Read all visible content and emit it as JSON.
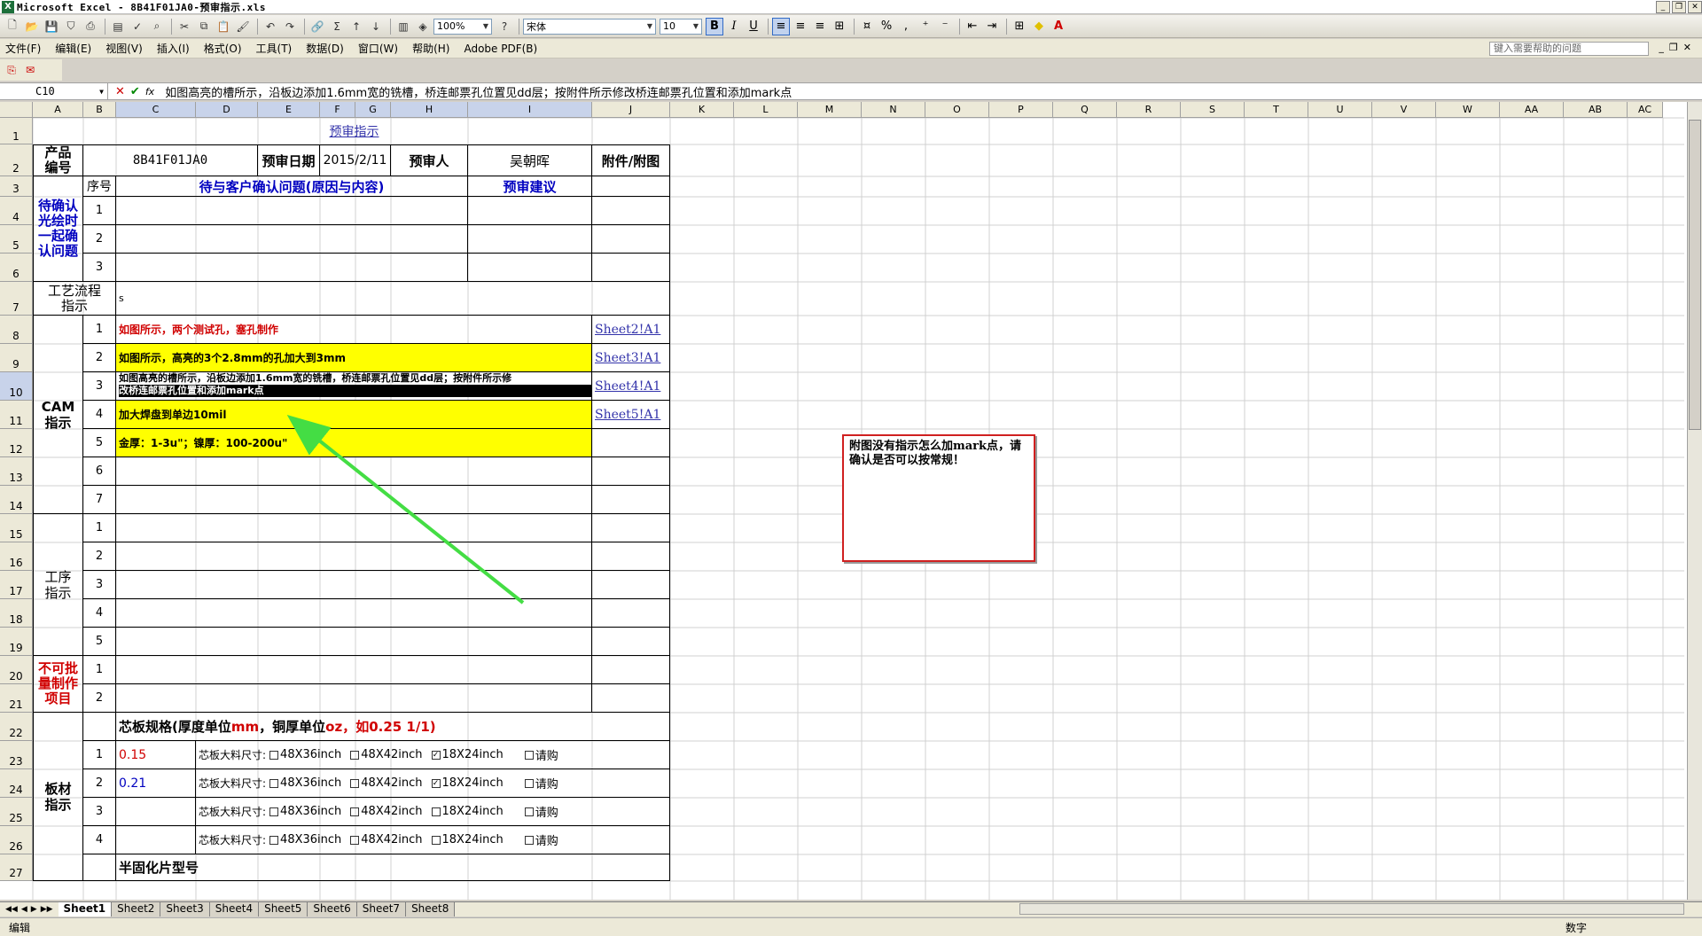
{
  "title": "Microsoft Excel - 8B41F01JA0-预审指示.xls",
  "toolbar": {
    "zoom": "100%",
    "font": "宋体",
    "size": "10",
    "bold": "B",
    "italic": "I",
    "underline": "U"
  },
  "menu": [
    "文件(F)",
    "编辑(E)",
    "视图(V)",
    "插入(I)",
    "格式(O)",
    "工具(T)",
    "数据(D)",
    "窗口(W)",
    "帮助(H)",
    "Adobe PDF(B)"
  ],
  "help_placeholder": "键入需要帮助的问题",
  "formula": {
    "cell": "C10",
    "value": "如图高亮的槽所示，沿板边添加1.6mm宽的铣槽，桥连邮票孔位置见dd层；按附件所示修改桥连邮票孔位置和添加mark点"
  },
  "columns": [
    "A",
    "B",
    "C",
    "D",
    "E",
    "F",
    "G",
    "H",
    "I",
    "J",
    "K",
    "L",
    "M",
    "N",
    "O",
    "P",
    "Q",
    "R",
    "S",
    "T",
    "U",
    "V",
    "W",
    "AA",
    "AB",
    "AC"
  ],
  "rows": [
    "1",
    "2",
    "3",
    "4",
    "5",
    "6",
    "7",
    "8",
    "9",
    "10",
    "11",
    "12",
    "13",
    "14",
    "15",
    "16",
    "17",
    "18",
    "19",
    "20",
    "21",
    "22",
    "23",
    "24",
    "25",
    "26",
    "27"
  ],
  "sheet": {
    "title_link": "预审指示",
    "product_label": "产品\n编号",
    "product_no": "8B41F01JA0",
    "date_label": "预审日期",
    "date": "2015/2/11",
    "reviewer_label": "预审人",
    "reviewer": "吴朝晖",
    "attach_label": "附件/附图",
    "seq_label": "序号",
    "issues_header": "待与客户确认问题(原因与内容)",
    "advice_header": "预审建议",
    "pending_label": "待确认\n光绘时\n一起确\n认问题",
    "process_label": "工艺流程\n指示",
    "process_value": "s",
    "cam_label": "CAM\n指示",
    "step_label": "工序\n指示",
    "no_batch_label": "不可批\n量制作\n项目",
    "board_label": "板材\n指示",
    "cam_items": [
      "如图所示，两个测试孔，塞孔制作",
      "如图所示，高亮的3个2.8mm的孔加大到3mm",
      "如图高亮的槽所示，沿板边添加1.6mm宽的铣槽，桥连邮票孔位置见dd层；按附件所示修",
      "加大焊盘到单边10mil",
      "金厚：1-3u\"；镍厚：100-200u\""
    ],
    "cam_item3_line2": "改桥连邮票孔位置和添加mark点",
    "cam_links": [
      "Sheet2!A1",
      "Sheet3!A1",
      "Sheet4!A1",
      "Sheet5!A1"
    ],
    "core_header": "芯板规格(厚度单位mm，铜厚单位oz，如0.25 1/1)",
    "core_header_a": "芯板规格(厚度单位",
    "core_header_b": "mm",
    "core_header_c": "，铜厚单位",
    "core_header_d": "oz",
    "core_header_e": "，如0.25 1/1)",
    "core_thickness": [
      "0.15",
      "0.21"
    ],
    "core_size_label": "芯板大料尺寸:",
    "size_opts": [
      "48X36inch",
      "48X42inch",
      "18X24inch"
    ],
    "purchase": "请购",
    "prepreg_label": "半固化片型号",
    "nums": [
      "1",
      "2",
      "3",
      "4",
      "5",
      "6",
      "7"
    ]
  },
  "memo": "附图没有指示怎么加mark点，请确认是否可以按常规！",
  "tabs": [
    "Sheet1",
    "Sheet2",
    "Sheet3",
    "Sheet4",
    "Sheet5",
    "Sheet6",
    "Sheet7",
    "Sheet8"
  ],
  "status": {
    "left": "编辑",
    "right": "数字"
  }
}
